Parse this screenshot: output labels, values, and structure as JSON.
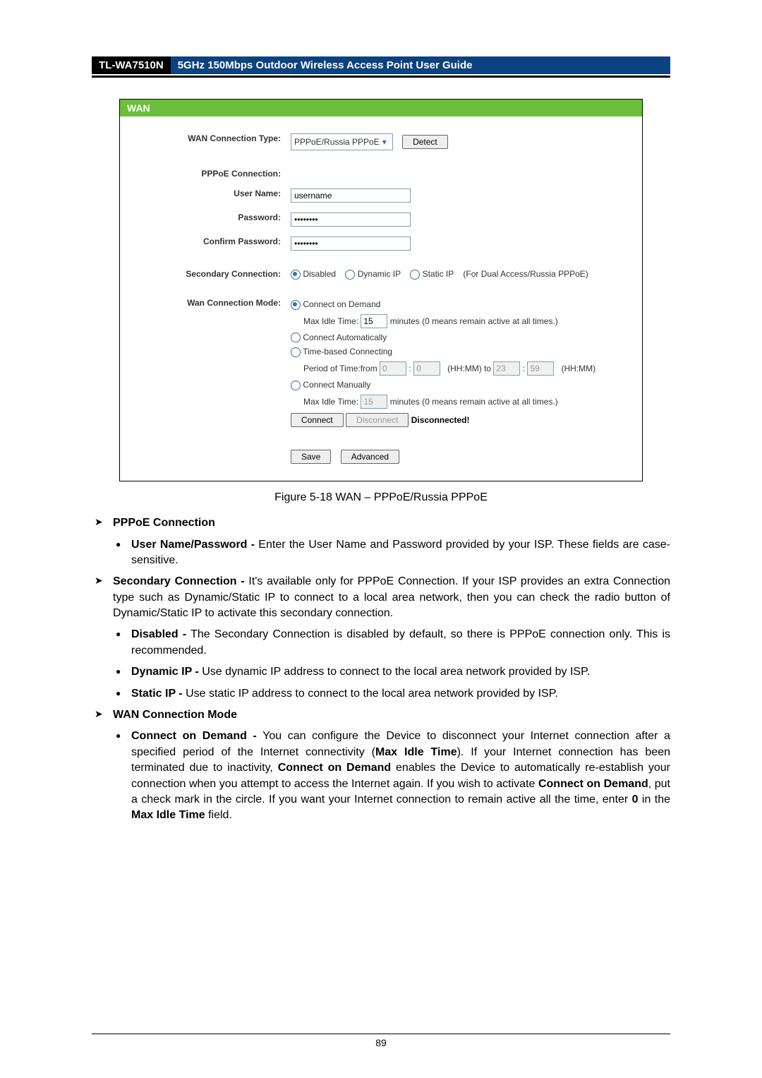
{
  "header": {
    "model": "TL-WA7510N",
    "title": "5GHz 150Mbps Outdoor Wireless Access Point User Guide"
  },
  "wan": {
    "panel_title": "WAN",
    "connection_type_label": "WAN Connection Type:",
    "connection_type_value": "PPPoE/Russia PPPoE",
    "detect_btn": "Detect",
    "pppoe_connection_label": "PPPoE Connection:",
    "user_name_label": "User Name:",
    "user_name_value": "username",
    "password_label": "Password:",
    "password_value": "••••••••",
    "confirm_password_label": "Confirm Password:",
    "confirm_password_value": "••••••••",
    "secondary_label": "Secondary Connection:",
    "sec_disabled": "Disabled",
    "sec_dynamic": "Dynamic IP",
    "sec_static": "Static IP",
    "sec_suffix": "(For Dual Access/Russia PPPoE)",
    "mode_label": "Wan Connection Mode:",
    "mode_demand": "Connect on Demand",
    "max_idle_label": "Max Idle Time:",
    "max_idle_val1": "15",
    "max_idle_val2": "15",
    "max_idle_suffix": "minutes (0 means remain active at all times.)",
    "mode_auto": "Connect Automatically",
    "mode_time": "Time-based Connecting",
    "period_label": "Period of Time:from",
    "period_from_hh": "0",
    "period_from_mm": "0",
    "period_mid": "(HH:MM) to",
    "period_to_hh": "23",
    "period_to_mm": "59",
    "period_end": "(HH:MM)",
    "mode_manual": "Connect Manually",
    "connect_btn": "Connect",
    "disconnect_btn": "Disconnect",
    "status": "Disconnected!",
    "save_btn": "Save",
    "advanced_btn": "Advanced"
  },
  "figure_caption": "Figure 5-18 WAN – PPPoE/Russia PPPoE",
  "text": {
    "pppoe_heading": "PPPoE Connection",
    "user_pw_bold": "User Name/Password -",
    "user_pw_rest": " Enter the User Name and Password provided by your ISP. These fields are case-sensitive.",
    "secondary_bold": "Secondary Connection -",
    "secondary_rest": " It's available only for PPPoE Connection. If your ISP provides an extra Connection type such as Dynamic/Static IP to connect to a local area network, then you can check the radio button of Dynamic/Static IP to activate this secondary connection.",
    "disabled_bold": "Disabled -",
    "disabled_rest": " The Secondary Connection is disabled by default, so there is PPPoE connection only. This is recommended.",
    "dynamic_bold": "Dynamic IP -",
    "dynamic_rest": " Use dynamic IP address to connect to the local area network provided by ISP.",
    "static_bold": "Static IP -",
    "static_rest": " Use static IP address to connect to the local area network provided by ISP.",
    "mode_heading": "WAN Connection Mode",
    "demand_bold": "Connect on Demand -",
    "demand_p1": " You can configure the Device to disconnect your Internet connection after a specified period of the Internet connectivity (",
    "demand_b1": "Max Idle Time",
    "demand_p2": "). If your Internet connection has been terminated due to inactivity, ",
    "demand_b2": "Connect on Demand",
    "demand_p3": " enables the Device to automatically re-establish your connection when you attempt to access the Internet again. If you wish to activate ",
    "demand_b3": "Connect on Demand",
    "demand_p4": ", put a check mark in the circle. If you want your Internet connection to remain active all the time, enter ",
    "demand_b4": "0",
    "demand_p5": " in the ",
    "demand_b5": "Max Idle Time",
    "demand_p6": " field."
  },
  "page_number": "89"
}
